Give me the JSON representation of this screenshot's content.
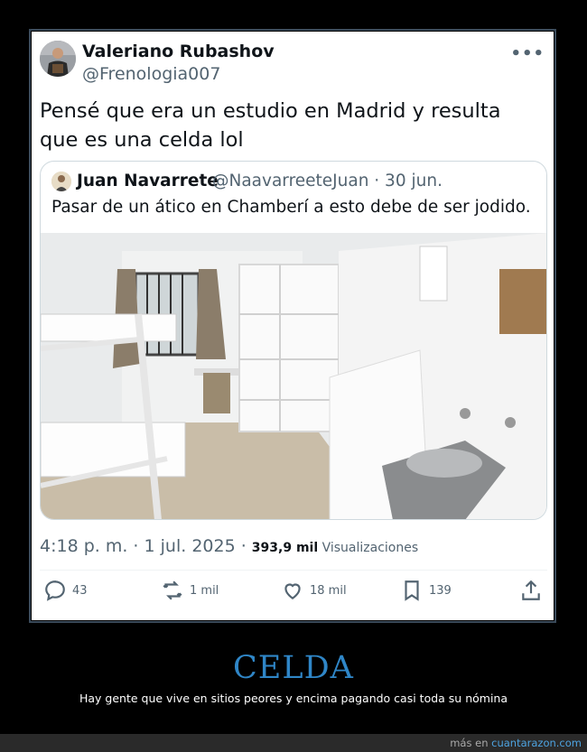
{
  "tweet": {
    "author_name": "Valeriano Rubashov",
    "author_handle": "@Frenologia007",
    "more_label": "•••",
    "text": "Pensé que era un estudio en Madrid y resulta que es una celda lol",
    "quote": {
      "author_name": "Juan Navarrete",
      "author_meta": "@NaavarreeteJuan · 30 jun.",
      "text": "Pasar de un ático en Chamberí a esto debe de ser jodido."
    },
    "timestamp": "4:18 p. m. · 1 jul. 2025 · ",
    "views_count": "393,9 mil",
    "views_label": " Visualizaciones",
    "actions": {
      "replies": "43",
      "retweets": "1 mil",
      "likes": "18 mil",
      "bookmarks": "139"
    }
  },
  "caption": {
    "title": "CELDA",
    "subtitle": "Hay gente que vive en sitios peores y encima pagando casi toda su nómina"
  },
  "footer": {
    "prefix": "más en ",
    "site": "cuantarazon.com"
  },
  "colors": {
    "accent_title": "#2f86c7",
    "footer_link": "#4ea3e0",
    "text_primary": "#0f1419",
    "text_secondary": "#536471"
  }
}
